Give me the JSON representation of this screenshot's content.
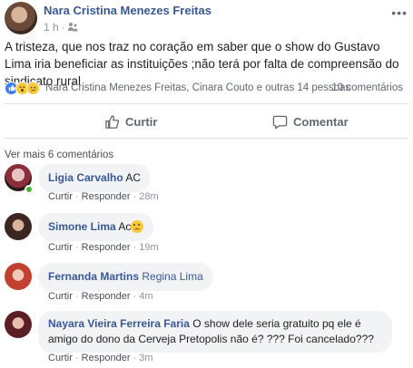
{
  "post": {
    "author": "Nara Cristina Menezes Freitas",
    "time": "1 h",
    "separator": "·",
    "more_label": "•••",
    "text": "A tristeza, que nos traz no coração em saber que o show do Gustavo Lima iria beneficiar as instituições ;não terá por falta de compreensão do sindicato rural",
    "reactions_text": "Nara Cristina Menezes Freitas, Cinara Couto e outras 14 pessoas",
    "comments_count": "10 comentários",
    "like_label": "Curtir",
    "comment_label": "Comentar",
    "reaction_icons": [
      "like-icon",
      "wow-icon",
      "sad-icon"
    ],
    "audience_icon": "friends-icon"
  },
  "comments_section": {
    "more_comments_label": "Ver mais 6 comentários",
    "comments": [
      {
        "name": "Ligia Carvalho",
        "text": "AC",
        "like": "Curtir",
        "reply": "Responder",
        "time": "28m"
      },
      {
        "name": "Simone Lima",
        "text": "Ac",
        "like": "Curtir",
        "reply": "Responder",
        "time": "19m"
      },
      {
        "name": "Fernanda Martins",
        "text": "Regina Lima",
        "like": "Curtir",
        "reply": "Responder",
        "time": "4m"
      },
      {
        "name": "Nayara Vieira Ferreira Faria",
        "text": "O show dele seria gratuito pq ele é amigo do dono da Cerveja Pretopolis não é? ??? Foi cancelado???",
        "like": "Curtir",
        "reply": "Responder",
        "time": "3m"
      }
    ]
  },
  "colors": {
    "name_link": "#385898",
    "meta": "#90949c",
    "bubble": "#f2f3f5",
    "online": "#42b72a"
  }
}
